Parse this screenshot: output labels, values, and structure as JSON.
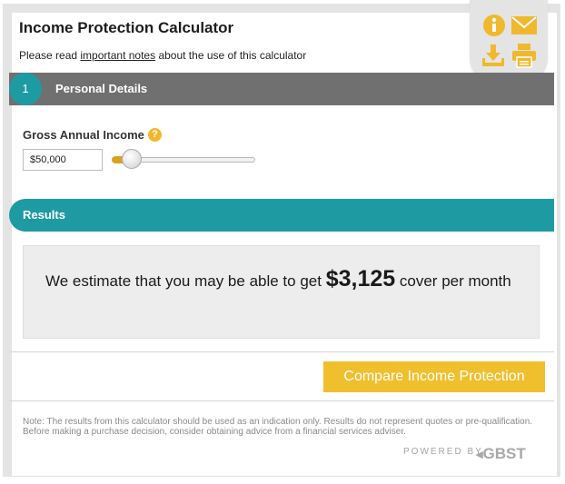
{
  "header": {
    "title": "Income Protection Calculator",
    "notes_prefix": "Please read ",
    "notes_link": "important notes",
    "notes_suffix": " about the use of this calculator"
  },
  "icon_tab": {
    "icons": [
      "info-icon",
      "email-icon",
      "download-icon",
      "print-icon"
    ],
    "color": "#f0b82e"
  },
  "personal_details": {
    "step_number": "1",
    "label": "Personal Details"
  },
  "income": {
    "label": "Gross Annual Income",
    "help_glyph": "?",
    "value": "$50,000",
    "slider_position_fraction": 0.05
  },
  "results": {
    "label": "Results",
    "text_before": "We estimate that you may be able to get ",
    "amount": "$3,125",
    "text_after": " cover per month"
  },
  "actions": {
    "compare_label": "Compare Income Protection"
  },
  "footer": {
    "note": "Note: The results from this calculator should be used as an indication only. Results do not represent quotes or pre-qualification. Before making a purchase decision, consider obtaining advice from a financial services adviser.",
    "powered_by": "POWERED BY",
    "logo_text": "GBST"
  },
  "colors": {
    "accent_teal": "#1e9aa3",
    "accent_yellow": "#f0bf2e",
    "section_grey": "#707070"
  }
}
